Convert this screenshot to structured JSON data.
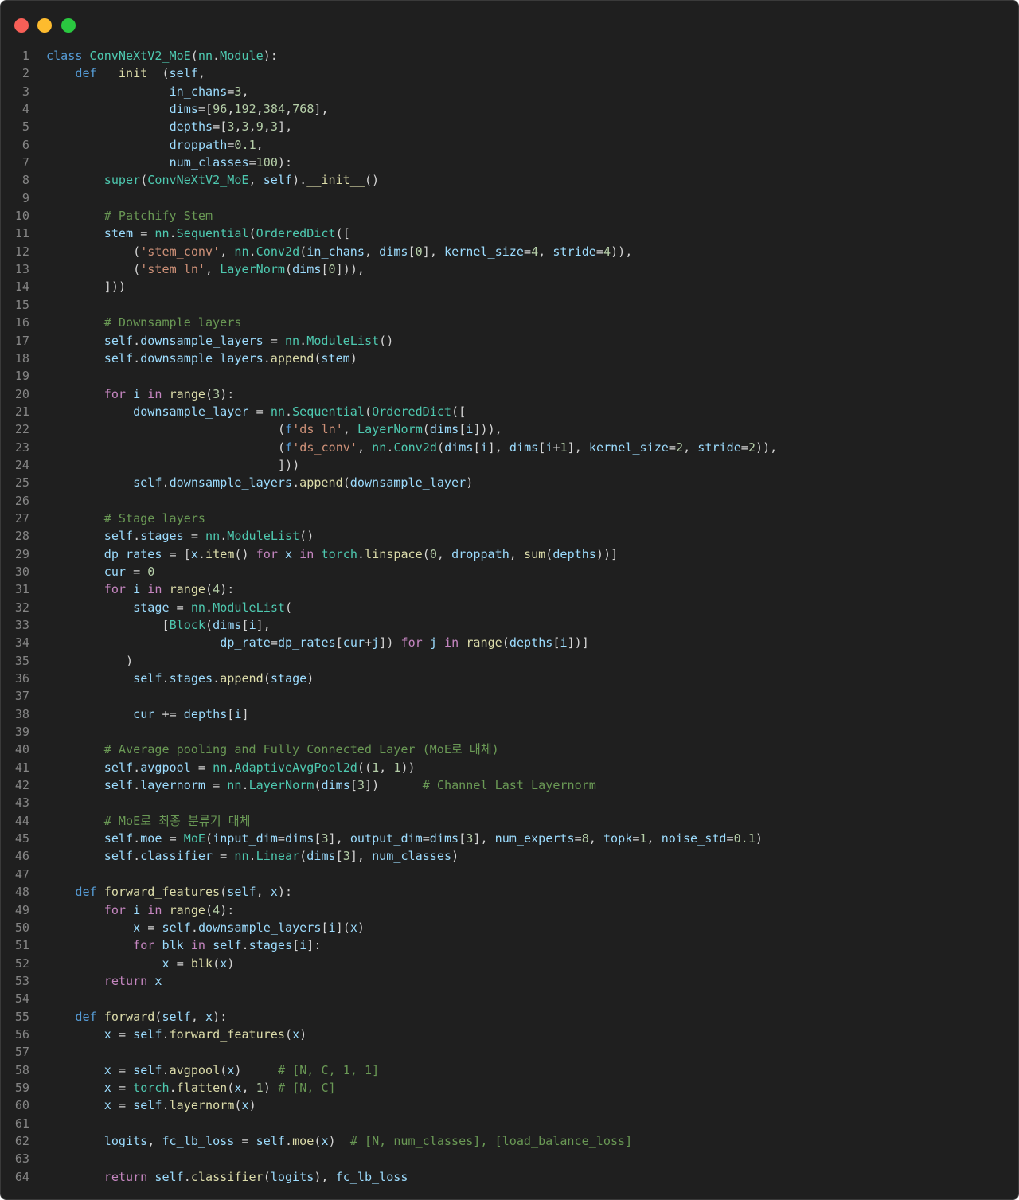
{
  "window": {
    "controls": {
      "close": "#f75f57",
      "minimize": "#fdbb2e",
      "maximize": "#2ac840"
    }
  },
  "theme": {
    "background": "#1f1f1f",
    "keyword": "#569cd6",
    "control": "#c586c0",
    "type": "#4ec9b0",
    "function": "#dcdcaa",
    "variable": "#9cdcfe",
    "string": "#ce9178",
    "number": "#b5cea8",
    "comment": "#6a9955",
    "line_number": "#858585"
  },
  "code": {
    "language": "python",
    "lines": [
      "class ConvNeXtV2_MoE(nn.Module):",
      "    def __init__(self,",
      "                 in_chans=3,",
      "                 dims=[96,192,384,768],",
      "                 depths=[3,3,9,3],",
      "                 droppath=0.1,",
      "                 num_classes=100):",
      "        super(ConvNeXtV2_MoE, self).__init__()",
      "",
      "        # Patchify Stem",
      "        stem = nn.Sequential(OrderedDict([",
      "            ('stem_conv', nn.Conv2d(in_chans, dims[0], kernel_size=4, stride=4)),",
      "            ('stem_ln', LayerNorm(dims[0])),",
      "        ]))",
      "",
      "        # Downsample layers",
      "        self.downsample_layers = nn.ModuleList()",
      "        self.downsample_layers.append(stem)",
      "",
      "        for i in range(3):",
      "            downsample_layer = nn.Sequential(OrderedDict([",
      "                                (f'ds_ln', LayerNorm(dims[i])),",
      "                                (f'ds_conv', nn.Conv2d(dims[i], dims[i+1], kernel_size=2, stride=2)),",
      "                                ]))",
      "            self.downsample_layers.append(downsample_layer)",
      "",
      "        # Stage layers",
      "        self.stages = nn.ModuleList()",
      "        dp_rates = [x.item() for x in torch.linspace(0, droppath, sum(depths))]",
      "        cur = 0",
      "        for i in range(4):",
      "            stage = nn.ModuleList(",
      "                [Block(dims[i],",
      "                        dp_rate=dp_rates[cur+j]) for j in range(depths[i])]",
      "           )",
      "            self.stages.append(stage)",
      "",
      "            cur += depths[i]",
      "",
      "        # Average pooling and Fully Connected Layer (MoE로 대체)",
      "        self.avgpool = nn.AdaptiveAvgPool2d((1, 1))",
      "        self.layernorm = nn.LayerNorm(dims[3])      # Channel Last Layernorm",
      "",
      "        # MoE로 최종 분류기 대체",
      "        self.moe = MoE(input_dim=dims[3], output_dim=dims[3], num_experts=8, topk=1, noise_std=0.1)",
      "        self.classifier = nn.Linear(dims[3], num_classes)",
      "",
      "    def forward_features(self, x):",
      "        for i in range(4):",
      "            x = self.downsample_layers[i](x)",
      "            for blk in self.stages[i]:",
      "                x = blk(x)",
      "        return x",
      "",
      "    def forward(self, x):",
      "        x = self.forward_features(x)",
      "",
      "        x = self.avgpool(x)     # [N, C, 1, 1]",
      "        x = torch.flatten(x, 1) # [N, C]",
      "        x = self.layernorm(x)",
      "",
      "        logits, fc_lb_loss = self.moe(x)  # [N, num_classes], [load_balance_loss]",
      "",
      "        return self.classifier(logits), fc_lb_loss"
    ]
  }
}
